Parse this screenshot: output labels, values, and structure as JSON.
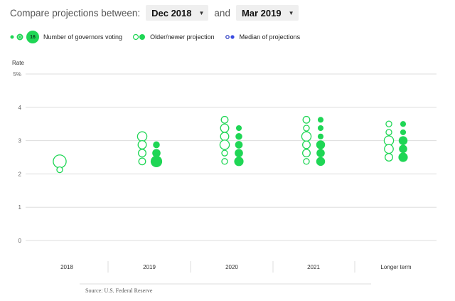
{
  "controls": {
    "prefix": "Compare projections between:",
    "from": "Dec 2018",
    "conjunction": "and",
    "to": "Mar 2019"
  },
  "legend": {
    "size_example_label": "16",
    "size_label": "Number of governors voting",
    "projection_label": "Older/newer projection",
    "median_label": "Median of projections"
  },
  "colors": {
    "green": "#1fd655",
    "median_dark": "#1f2fbf",
    "median_blue": "#3b4ce0",
    "grid": "#dddddd",
    "axis_text": "#666666"
  },
  "source": "Source: U.S. Federal Reserve",
  "chart_data": {
    "type": "scatter",
    "ylabel": "Rate",
    "ylim": [
      0,
      5
    ],
    "yticks": [
      {
        "v": 0,
        "label": "0"
      },
      {
        "v": 1,
        "label": "1"
      },
      {
        "v": 2,
        "label": "2"
      },
      {
        "v": 3,
        "label": "3"
      },
      {
        "v": 4,
        "label": "4"
      },
      {
        "v": 5,
        "label": "5%"
      }
    ],
    "categories": [
      "2018",
      "2019",
      "2020",
      "2021",
      "Longer term"
    ],
    "series": [
      {
        "name": "Dec 2018",
        "style": "open",
        "points": [
          {
            "category": "2018",
            "rate": 2.375,
            "count": 15
          },
          {
            "category": "2018",
            "rate": 2.125,
            "count": 1
          },
          {
            "category": "2019",
            "rate": 3.125,
            "count": 6
          },
          {
            "category": "2019",
            "rate": 2.875,
            "count": 4
          },
          {
            "category": "2019",
            "rate": 2.625,
            "count": 3
          },
          {
            "category": "2019",
            "rate": 2.375,
            "count": 2
          },
          {
            "category": "2020",
            "rate": 3.625,
            "count": 2
          },
          {
            "category": "2020",
            "rate": 3.375,
            "count": 4
          },
          {
            "category": "2020",
            "rate": 3.125,
            "count": 4
          },
          {
            "category": "2020",
            "rate": 2.875,
            "count": 6
          },
          {
            "category": "2020",
            "rate": 2.625,
            "count": 1
          },
          {
            "category": "2020",
            "rate": 2.375,
            "count": 1
          },
          {
            "category": "2021",
            "rate": 3.625,
            "count": 2
          },
          {
            "category": "2021",
            "rate": 3.375,
            "count": 1
          },
          {
            "category": "2021",
            "rate": 3.125,
            "count": 6
          },
          {
            "category": "2021",
            "rate": 2.875,
            "count": 3
          },
          {
            "category": "2021",
            "rate": 2.625,
            "count": 3
          },
          {
            "category": "2021",
            "rate": 2.375,
            "count": 1
          },
          {
            "category": "Longer term",
            "rate": 3.5,
            "count": 1
          },
          {
            "category": "Longer term",
            "rate": 3.25,
            "count": 1
          },
          {
            "category": "Longer term",
            "rate": 3.0,
            "count": 6
          },
          {
            "category": "Longer term",
            "rate": 2.75,
            "count": 5
          },
          {
            "category": "Longer term",
            "rate": 2.5,
            "count": 3
          }
        ]
      },
      {
        "name": "Mar 2019",
        "style": "filled",
        "points": [
          {
            "category": "2019",
            "rate": 2.875,
            "count": 2
          },
          {
            "category": "2019",
            "rate": 2.625,
            "count": 4
          },
          {
            "category": "2019",
            "rate": 2.375,
            "count": 11
          },
          {
            "category": "2020",
            "rate": 3.375,
            "count": 1
          },
          {
            "category": "2020",
            "rate": 3.125,
            "count": 2
          },
          {
            "category": "2020",
            "rate": 2.875,
            "count": 3
          },
          {
            "category": "2020",
            "rate": 2.625,
            "count": 4
          },
          {
            "category": "2020",
            "rate": 2.375,
            "count": 6
          },
          {
            "category": "2021",
            "rate": 3.625,
            "count": 1
          },
          {
            "category": "2021",
            "rate": 3.375,
            "count": 1
          },
          {
            "category": "2021",
            "rate": 3.125,
            "count": 1
          },
          {
            "category": "2021",
            "rate": 2.875,
            "count": 5
          },
          {
            "category": "2021",
            "rate": 2.625,
            "count": 4
          },
          {
            "category": "2021",
            "rate": 2.375,
            "count": 5
          },
          {
            "category": "Longer term",
            "rate": 3.5,
            "count": 1
          },
          {
            "category": "Longer term",
            "rate": 3.25,
            "count": 1
          },
          {
            "category": "Longer term",
            "rate": 3.0,
            "count": 5
          },
          {
            "category": "Longer term",
            "rate": 2.75,
            "count": 4
          },
          {
            "category": "Longer term",
            "rate": 2.5,
            "count": 6
          }
        ]
      }
    ]
  }
}
